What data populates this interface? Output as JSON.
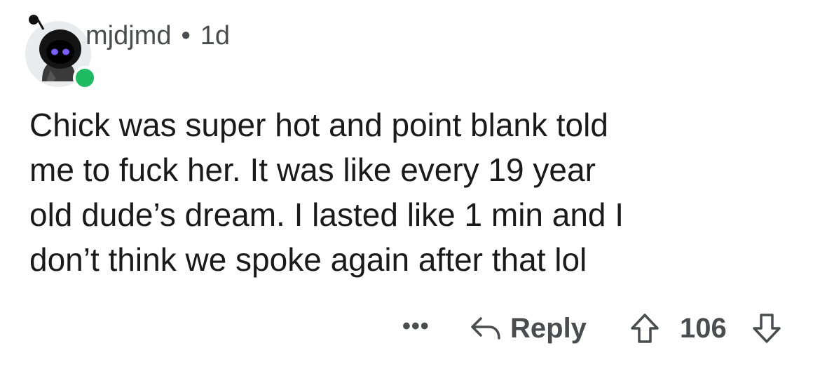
{
  "comment": {
    "author": "mjdjmd",
    "separator": "•",
    "age": "1d",
    "body_lines": [
      "Chick was super hot and point blank told",
      "me to fuck her. It was like every 19 year",
      "old dude’s dream. I lasted like 1 min and I",
      "don’t think we spoke again after that lol"
    ],
    "avatar_icon": "snoo-avatar-icon",
    "online_status_color": "#1ebc62"
  },
  "actions": {
    "more_label": "•••",
    "reply_label": "Reply",
    "reply_icon": "reply-arrow-icon",
    "upvote_icon": "upvote-arrow-icon",
    "vote_count": "106",
    "downvote_icon": "downvote-arrow-icon"
  }
}
